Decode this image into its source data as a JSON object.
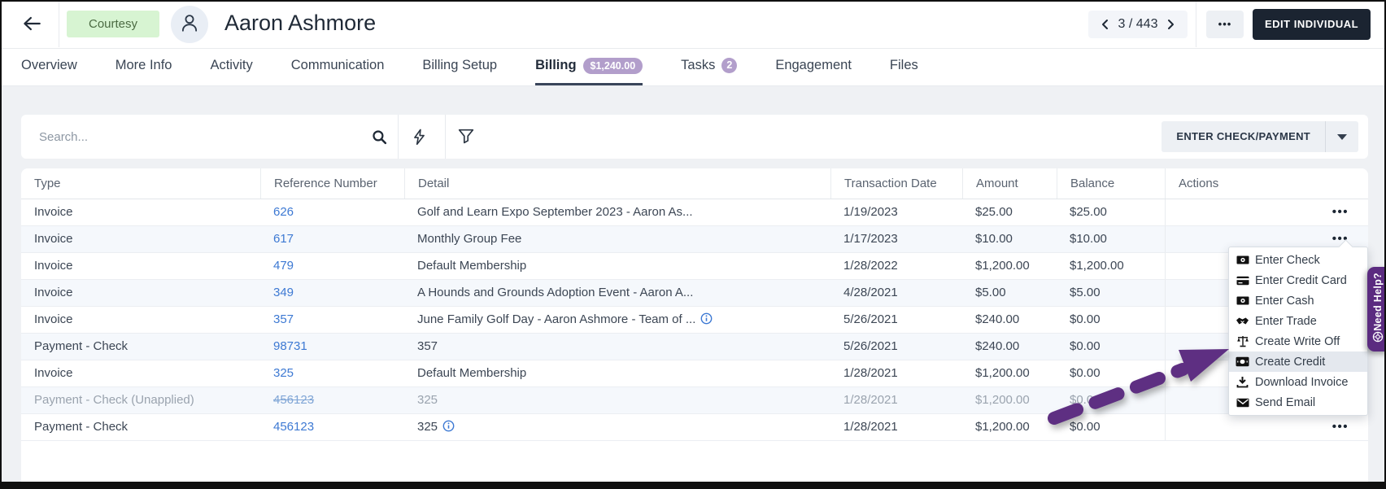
{
  "colors": {
    "accent_purple": "#5e2f82",
    "badge_purple": "#b29ecb",
    "link_blue": "#3d79d3",
    "status_badge_green_bg": "#d7f4d2",
    "status_badge_green_text": "#4c6b43",
    "dark_button_bg": "#1b2431",
    "row_alt_bg": "#f5f8fc"
  },
  "header": {
    "back_icon": "back-arrow",
    "status_badge": "Courtesy",
    "avatar_icon": "person",
    "title": "Aaron Ashmore",
    "pagination": {
      "display": "3 / 443",
      "prev_icon": "chevron-left",
      "next_icon": "chevron-right"
    },
    "more_button": "•••",
    "edit_button": "EDIT INDIVIDUAL"
  },
  "tabs": [
    {
      "label": "Overview"
    },
    {
      "label": "More Info"
    },
    {
      "label": "Activity"
    },
    {
      "label": "Communication"
    },
    {
      "label": "Billing Setup"
    },
    {
      "label": "Billing",
      "active": true,
      "badge": "$1,240.00",
      "badge_shape": "pill"
    },
    {
      "label": "Tasks",
      "badge": "2",
      "badge_shape": "circle"
    },
    {
      "label": "Engagement"
    },
    {
      "label": "Files"
    }
  ],
  "toolbar": {
    "search_placeholder": "Search...",
    "search_icon": "magnifier",
    "quick_icon": "lightning-bolt",
    "filter_icon": "funnel",
    "primary_button": "ENTER CHECK/PAYMENT"
  },
  "table": {
    "columns": [
      "Type",
      "Reference Number",
      "Detail",
      "Transaction Date",
      "Amount",
      "Balance",
      "Actions"
    ],
    "row_actions_icon": "•••",
    "rows": [
      {
        "type": "Invoice",
        "reference": "626",
        "detail": "Golf and Learn Expo September 2023 - Aaron As...",
        "transaction_date": "1/19/2023",
        "amount": "$25.00",
        "balance": "$25.00"
      },
      {
        "type": "Invoice",
        "reference": "617",
        "detail": "Monthly Group Fee",
        "transaction_date": "1/17/2023",
        "amount": "$10.00",
        "balance": "$10.00"
      },
      {
        "type": "Invoice",
        "reference": "479",
        "detail": "Default Membership",
        "transaction_date": "1/28/2022",
        "amount": "$1,200.00",
        "balance": "$1,200.00"
      },
      {
        "type": "Invoice",
        "reference": "349",
        "detail": "A Hounds and Grounds Adoption Event - Aaron A...",
        "transaction_date": "4/28/2021",
        "amount": "$5.00",
        "balance": "$5.00"
      },
      {
        "type": "Invoice",
        "reference": "357",
        "detail": "June Family Golf Day - Aaron Ashmore - Team of ...",
        "detail_info_icon": true,
        "transaction_date": "5/26/2021",
        "amount": "$240.00",
        "balance": "$0.00"
      },
      {
        "type": "Payment - Check",
        "reference": "98731",
        "detail": "357",
        "transaction_date": "5/26/2021",
        "amount": "$240.00",
        "balance": "$0.00"
      },
      {
        "type": "Invoice",
        "reference": "325",
        "detail": "Default Membership",
        "transaction_date": "1/28/2021",
        "amount": "$1,200.00",
        "balance": "$0.00"
      },
      {
        "type": "Payment - Check (Unapplied)",
        "reference": "456123",
        "reference_strikethrough": true,
        "muted": true,
        "detail": "325",
        "transaction_date": "1/28/2021",
        "amount": "$1,200.00",
        "balance": "$0.00"
      },
      {
        "type": "Payment - Check",
        "reference": "456123",
        "detail": "325",
        "detail_info_icon": true,
        "transaction_date": "1/28/2021",
        "amount": "$1,200.00",
        "balance": "$0.00"
      }
    ]
  },
  "action_menu": {
    "items": [
      {
        "label": "Enter Check",
        "icon": "banknote-icon"
      },
      {
        "label": "Enter Credit Card",
        "icon": "credit-card-icon"
      },
      {
        "label": "Enter Cash",
        "icon": "cash-icon"
      },
      {
        "label": "Enter Trade",
        "icon": "handshake-icon"
      },
      {
        "label": "Create Write Off",
        "icon": "scales-icon"
      },
      {
        "label": "Create Credit",
        "icon": "banknote-bold-icon",
        "highlighted": true
      },
      {
        "label": "Download Invoice",
        "icon": "download-icon"
      },
      {
        "label": "Send Email",
        "icon": "envelope-icon"
      }
    ]
  },
  "annotation_arrow": {
    "color": "#5e2f82",
    "points_to": "Create Credit"
  },
  "help_tab": {
    "label": "Need Help?",
    "icon": "lifebuoy-icon"
  }
}
